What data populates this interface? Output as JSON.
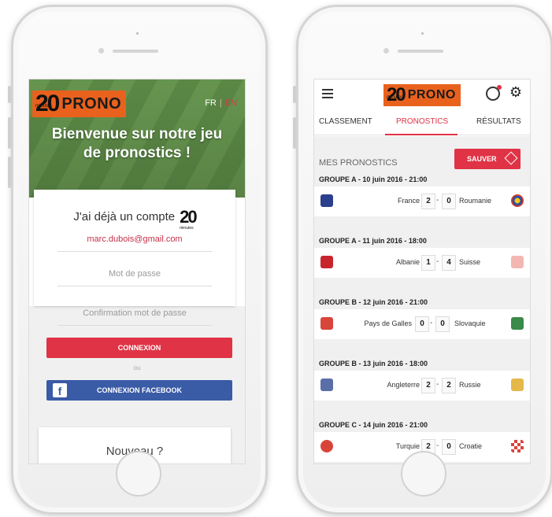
{
  "login": {
    "brand_20": "20",
    "brand_minutes": "minutes",
    "brand_prono": "PRONO",
    "lang_fr": "FR",
    "lang_sep": "|",
    "lang_en": "EN",
    "welcome": "Bienvenue sur notre jeu de pronostics !",
    "card_title": "J'ai déjà un compte",
    "mini_brand": "20",
    "mini_minutes": "minutes",
    "email_value": "marc.dubois@gmail.com",
    "password_placeholder": "Mot de passe",
    "confirm_placeholder": "Confirmation mot de passe",
    "login_button": "CONNEXION",
    "or": "ou",
    "fb_icon": "f",
    "facebook_button": "CONNEXION FACEBOOK",
    "new_user": "Nouveau ?"
  },
  "app": {
    "brand_20": "20",
    "brand_minutes": "minutes",
    "brand_prono": "PRONO",
    "tabs": [
      "CLASSEMENT",
      "PRONOSTICS",
      "RÉSULTATS"
    ],
    "section_title": "MES PRONOSTICS",
    "save_button": "SAUVER",
    "matches": [
      {
        "group": "GROUPE A - 10 juin 2016 - 21:00",
        "home": "France",
        "home_score": "2",
        "away_score": "0",
        "away": "Roumanie"
      },
      {
        "group": "GROUPE A - 11 juin 2016 - 18:00",
        "home": "Albanie",
        "home_score": "1",
        "away_score": "4",
        "away": "Suisse"
      },
      {
        "group": "GROUPE B - 12 juin 2016 - 21:00",
        "home": "Pays de Galles",
        "home_score": "0",
        "away_score": "0",
        "away": "Slovaquie"
      },
      {
        "group": "GROUPE B - 13 juin 2016 - 18:00",
        "home": "Angleterre",
        "home_score": "2",
        "away_score": "2",
        "away": "Russie"
      },
      {
        "group": "GROUPE C - 14 juin 2016 - 21:00",
        "home": "Turquie",
        "home_score": "2",
        "away_score": "0",
        "away": "Croatie"
      }
    ]
  },
  "colors": {
    "accent_red": "#e03346",
    "brand_orange": "#e8621e",
    "facebook_blue": "#3a5ba6",
    "pitch_green": "#6a9a52"
  }
}
